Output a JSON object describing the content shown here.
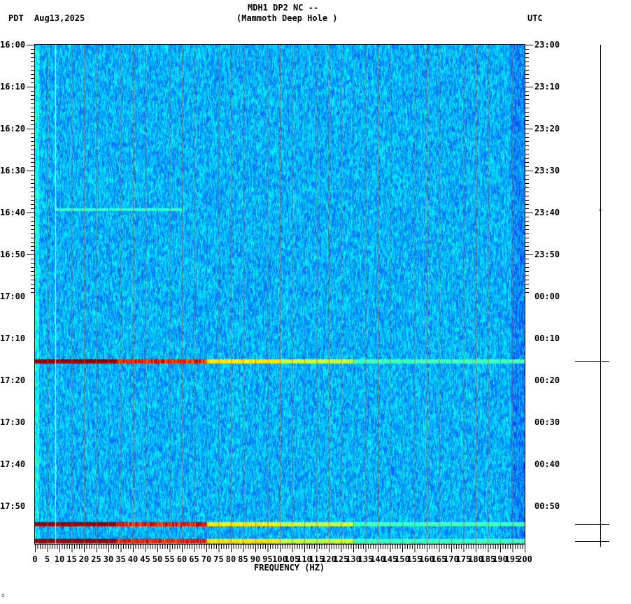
{
  "header": {
    "left_tz": "PDT",
    "date": "Aug13,2025",
    "title": "MDH1 DP2 NC --",
    "subtitle": "(Mammoth Deep Hole )",
    "right_tz": "UTC"
  },
  "footer_mark": "∴",
  "chart_data": {
    "type": "heatmap",
    "title": "MDH1 DP2 NC --",
    "subtitle": "(Mammoth Deep Hole )",
    "xlabel": "FREQUENCY (HZ)",
    "xlim": [
      0,
      200
    ],
    "x_ticks": [
      "0",
      "5",
      "10",
      "15",
      "20",
      "25",
      "30",
      "35",
      "40",
      "45",
      "50",
      "55",
      "60",
      "65",
      "70",
      "75",
      "80",
      "85",
      "90",
      "95",
      "100",
      "105",
      "110",
      "115",
      "120",
      "125",
      "130",
      "135",
      "140",
      "145",
      "150",
      "155",
      "160",
      "165",
      "170",
      "175",
      "180",
      "185",
      "190",
      "195",
      "200"
    ],
    "y_range_minutes": [
      0,
      59
    ],
    "y_ticks_pdt": [
      "16:00",
      "16:10",
      "16:20",
      "16:30",
      "16:40",
      "16:50",
      "17:00",
      "17:10",
      "17:20",
      "17:30",
      "17:40",
      "17:50"
    ],
    "y_ticks_utc": [
      "23:00",
      "23:10",
      "23:20",
      "23:30",
      "23:40",
      "23:50",
      "00:00",
      "00:10",
      "00:20",
      "00:30",
      "00:40",
      "00:50"
    ],
    "colormap": [
      "#00007f",
      "#0000ff",
      "#0080ff",
      "#00ffff",
      "#80ff80",
      "#ffff00",
      "#ff8000",
      "#ff0000",
      "#800000"
    ],
    "background_level": "low (blue)",
    "events": [
      {
        "minute": 39.3,
        "freq_range": [
          8,
          60
        ],
        "intensity": "weak"
      },
      {
        "minute": 75.5,
        "freq_range": [
          0,
          200
        ],
        "intensity": "strong"
      },
      {
        "minute": 114.3,
        "freq_range": [
          0,
          200
        ],
        "intensity": "strong"
      },
      {
        "minute": 118.3,
        "freq_range": [
          0,
          200
        ],
        "intensity": "strong"
      }
    ],
    "event_minutes_in_window": [
      39.3,
      75.5,
      114.3,
      118.3
    ]
  }
}
